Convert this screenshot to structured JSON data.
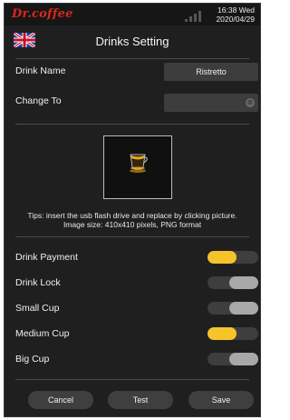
{
  "status": {
    "brand": "Dr.coffee",
    "time": "16:38 Wed",
    "date": "2020/04/29"
  },
  "header": {
    "title": "Drinks Setting",
    "language_icon": "uk-flag-icon"
  },
  "form": {
    "drink_name_label": "Drink Name",
    "drink_name_value": "Ristretto",
    "change_to_label": "Change To",
    "change_to_value": "",
    "clear_icon": "⊗"
  },
  "picture": {
    "icon": "espresso-cup-icon",
    "tips_line1": "Tips: insert the usb flash drive and replace by clicking picture.",
    "tips_line2": "Image size: 410x410 pixels, PNG format"
  },
  "toggles": [
    {
      "label": "Drink Payment",
      "on": true
    },
    {
      "label": "Drink Lock",
      "on": false
    },
    {
      "label": "Small Cup",
      "on": false
    },
    {
      "label": "Medium Cup",
      "on": true
    },
    {
      "label": "Big Cup",
      "on": false
    }
  ],
  "colors": {
    "on": "#f5c42a",
    "off": "#a8a8a8",
    "track": "#3e3e3e"
  },
  "buttons": {
    "cancel": "Cancel",
    "test": "Test",
    "save": "Save"
  }
}
